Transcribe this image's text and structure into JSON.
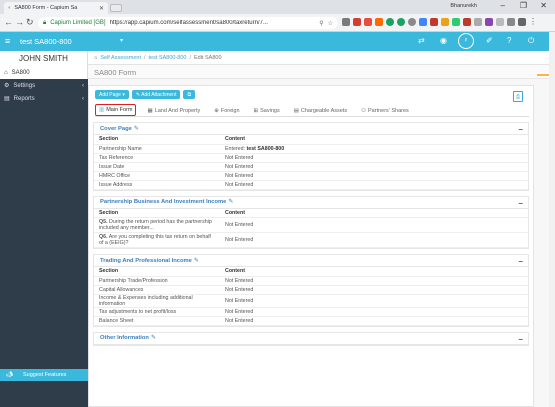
{
  "browser": {
    "tab_title": "SA800 Form - Capium Sa",
    "user_name": "Bhanurekh",
    "org": "Capium Limited [GB]",
    "url": "https://app.capium.com/selfassessment/sa800/taxreturn/7..."
  },
  "header": {
    "client": "test SA800-800",
    "notif_label": "ᵖ"
  },
  "sidebar": {
    "user": "JOHN SMITH",
    "items": [
      {
        "label": "SA800",
        "icon": "home-icon"
      },
      {
        "label": "Settings",
        "icon": "gear-icon"
      },
      {
        "label": "Reports",
        "icon": "file-icon"
      }
    ],
    "suggest": "Suggest Features"
  },
  "breadcrumb": [
    "Self Assessment",
    "test SA800-800",
    "Edit SA800"
  ],
  "page_title": "SA800 Form",
  "actions": {
    "add_page": "Add Page ▾",
    "add_attachment": "✎ Add Attachment",
    "extra": "⧉"
  },
  "tabs": [
    {
      "label": "Main Form",
      "active": true
    },
    {
      "label": "Land And Property"
    },
    {
      "label": "Foreign"
    },
    {
      "label": "Savings"
    },
    {
      "label": "Chargeable Assets"
    },
    {
      "label": "Partners' Shares"
    }
  ],
  "sections": {
    "cover": {
      "title": "Cover Page",
      "col_section": "Section",
      "col_content": "Content",
      "rows": [
        {
          "label": "Partnership Name",
          "value_prefix": "Entered: ",
          "value": "test SA800-800"
        },
        {
          "label": "Tax Reference",
          "value": "Not Entered"
        },
        {
          "label": "Issue Date",
          "value": "Not Entered"
        },
        {
          "label": "HMRC Office",
          "value": "Not Entered"
        },
        {
          "label": "Issue Address",
          "value": "Not Entered"
        }
      ]
    },
    "business": {
      "title": "Partnership Business And Investment Income",
      "col_section": "Section",
      "col_content": "Content",
      "rows": [
        {
          "label_bold": "Q5.",
          "label": " During the return period has the partnership included any member...",
          "value": "Not Entered"
        },
        {
          "label_bold": "Q6.",
          "label": " Are you completing this tax return on behalf of a (EEIG)?",
          "value": "Not Entered"
        }
      ]
    },
    "trading": {
      "title": "Trading And Professional Income",
      "col_section": "Section",
      "col_content": "Content",
      "rows": [
        {
          "label": "Partnership Trade/Profession",
          "value": "Not Entered"
        },
        {
          "label": "Capital Allowances",
          "value": "Not Entered"
        },
        {
          "label": "Income & Expenses including additional information",
          "value": "Not Entered"
        },
        {
          "label": "Tax adjustments to net profit/loss",
          "value": "Not Entered"
        },
        {
          "label": "Balance Sheet",
          "value": "Not Entered"
        }
      ]
    },
    "other": {
      "title": "Other Information"
    }
  }
}
